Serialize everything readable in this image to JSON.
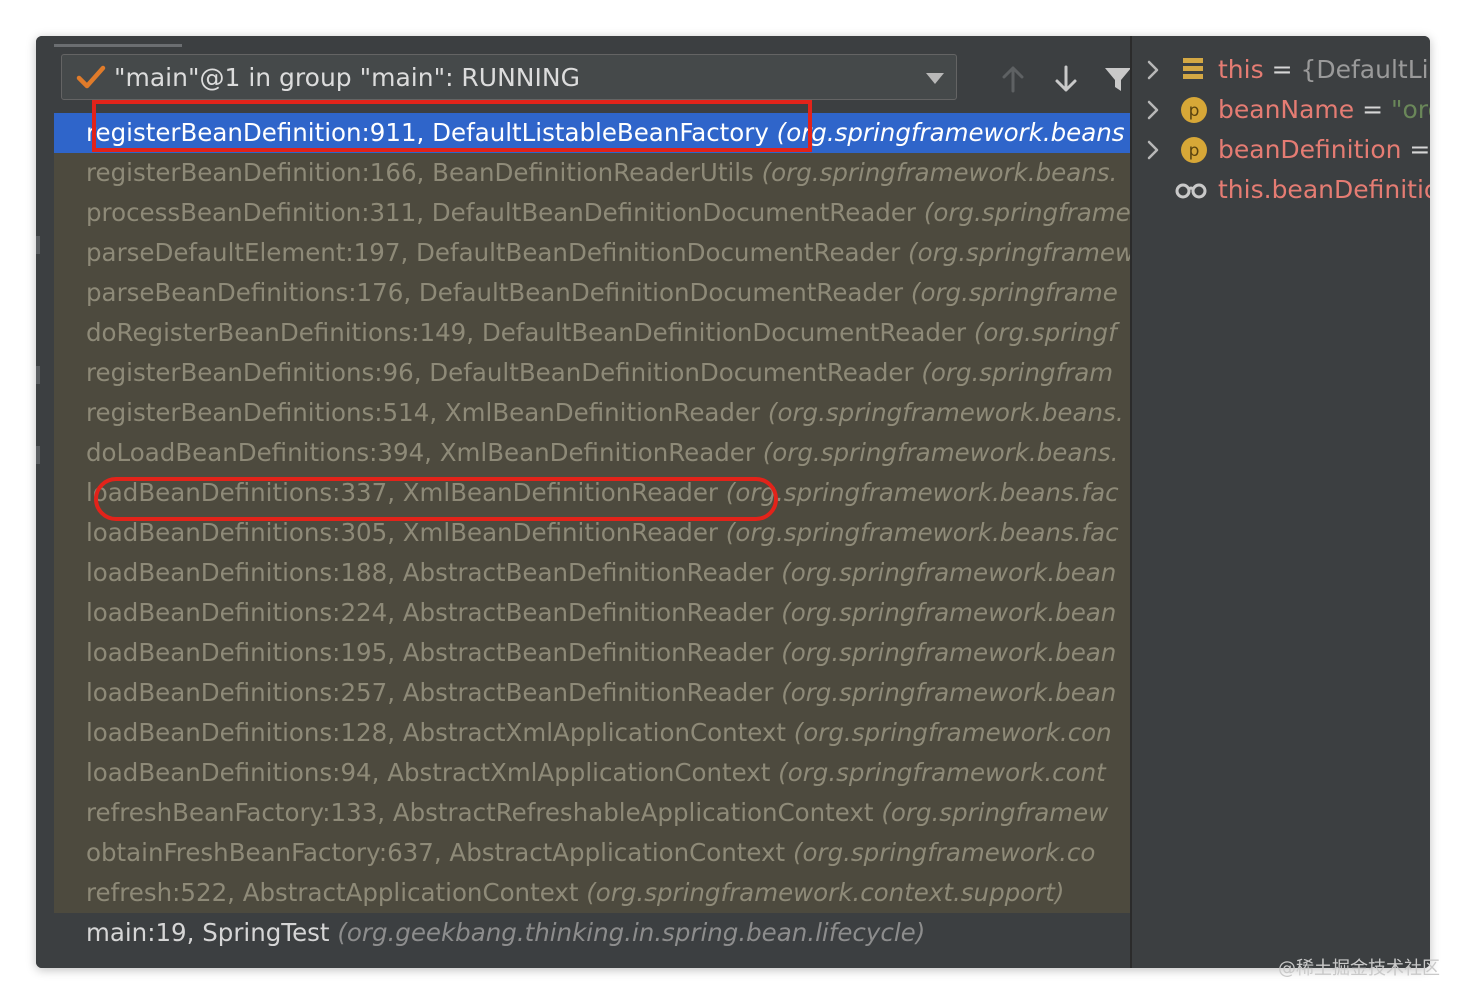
{
  "thread": {
    "label": "\"main\"@1 in group \"main\": RUNNING"
  },
  "toolbar": {
    "icons": [
      "arrow-up-icon",
      "arrow-down-icon",
      "filter-icon"
    ]
  },
  "frames": [
    {
      "method": "registerBeanDefinition:911, DefaultListableBeanFactory",
      "pkg": "(org.springframework.beans"
    },
    {
      "method": "registerBeanDefinition:166, BeanDefinitionReaderUtils",
      "pkg": "(org.springframework.beans."
    },
    {
      "method": "processBeanDefinition:311, DefaultBeanDefinitionDocumentReader",
      "pkg": "(org.springframe"
    },
    {
      "method": "parseDefaultElement:197, DefaultBeanDefinitionDocumentReader",
      "pkg": "(org.springframew"
    },
    {
      "method": "parseBeanDefinitions:176, DefaultBeanDefinitionDocumentReader",
      "pkg": "(org.springframe"
    },
    {
      "method": "doRegisterBeanDefinitions:149, DefaultBeanDefinitionDocumentReader",
      "pkg": "(org.springf"
    },
    {
      "method": "registerBeanDefinitions:96, DefaultBeanDefinitionDocumentReader",
      "pkg": "(org.springfram"
    },
    {
      "method": "registerBeanDefinitions:514, XmlBeanDefinitionReader",
      "pkg": "(org.springframework.beans."
    },
    {
      "method": "doLoadBeanDefinitions:394, XmlBeanDefinitionReader",
      "pkg": "(org.springframework.beans."
    },
    {
      "method": "loadBeanDefinitions:337, XmlBeanDefinitionReader",
      "pkg": "(org.springframework.beans.fac"
    },
    {
      "method": "loadBeanDefinitions:305, XmlBeanDefinitionReader",
      "pkg": "(org.springframework.beans.fac"
    },
    {
      "method": "loadBeanDefinitions:188, AbstractBeanDefinitionReader",
      "pkg": "(org.springframework.bean"
    },
    {
      "method": "loadBeanDefinitions:224, AbstractBeanDefinitionReader",
      "pkg": "(org.springframework.bean"
    },
    {
      "method": "loadBeanDefinitions:195, AbstractBeanDefinitionReader",
      "pkg": "(org.springframework.bean"
    },
    {
      "method": "loadBeanDefinitions:257, AbstractBeanDefinitionReader",
      "pkg": "(org.springframework.bean"
    },
    {
      "method": "loadBeanDefinitions:128, AbstractXmlApplicationContext",
      "pkg": "(org.springframework.con"
    },
    {
      "method": "loadBeanDefinitions:94, AbstractXmlApplicationContext",
      "pkg": "(org.springframework.cont"
    },
    {
      "method": "refreshBeanFactory:133, AbstractRefreshableApplicationContext",
      "pkg": "(org.springframew"
    },
    {
      "method": "obtainFreshBeanFactory:637, AbstractApplicationContext",
      "pkg": "(org.springframework.co"
    },
    {
      "method": "refresh:522, AbstractApplicationContext",
      "pkg": "(org.springframework.context.support)"
    },
    {
      "method": "main:19, SpringTest",
      "pkg": "(org.geekbang.thinking.in.spring.bean.lifecycle)"
    }
  ],
  "variables": [
    {
      "icon": "fields-icon",
      "name": "this",
      "eq": " = ",
      "value": "{DefaultLis",
      "kind": "obj",
      "expandable": true
    },
    {
      "icon": "parameter-icon",
      "name": "beanName",
      "eq": " = ",
      "value": "\"org",
      "kind": "str",
      "expandable": true
    },
    {
      "icon": "parameter-icon",
      "name": "beanDefinition",
      "eq": " =",
      "value": "",
      "kind": "obj",
      "expandable": true
    },
    {
      "icon": "watch-icon",
      "name": "this.beanDefinitio",
      "eq": "",
      "value": "",
      "kind": "obj",
      "expandable": false
    }
  ],
  "colors": {
    "selected": "#2f65ca",
    "library_frame_bg": "#4d4a3e",
    "panel_bg": "#3c3f41",
    "highlight": "#e2231a",
    "var_name": "#e57c73"
  },
  "watermark": "@稀土掘金技术社区"
}
